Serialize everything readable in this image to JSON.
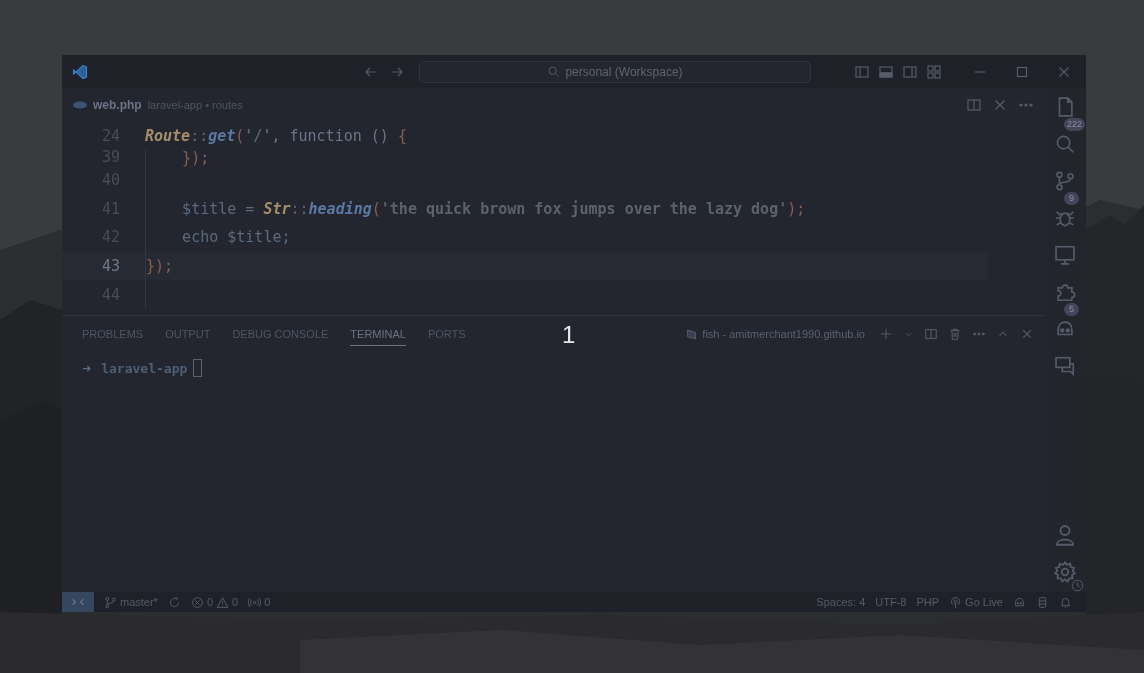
{
  "title_bar": {
    "search": "personal (Workspace)"
  },
  "editor_tab": {
    "file": "web.php",
    "breadcrumb": "laravel-app • routes"
  },
  "code": {
    "sticky": {
      "number": "24",
      "tokens": [
        {
          "text": "Route",
          "kind": "class"
        },
        {
          "text": "::",
          "kind": "op"
        },
        {
          "text": "get",
          "kind": "method"
        },
        {
          "text": "(",
          "kind": "paren"
        },
        {
          "text": "'/'",
          "kind": "string"
        },
        {
          "text": ", function () ",
          "kind": "keyword"
        },
        {
          "text": "{",
          "kind": "paren"
        }
      ]
    },
    "lines": [
      {
        "number": "39",
        "current": false,
        "tokens": [
          {
            "text": "    });",
            "kind": "paren"
          }
        ]
      },
      {
        "number": "40",
        "current": false
      },
      {
        "number": "41",
        "current": false,
        "tokens": [
          {
            "text": "    $title = ",
            "kind": "variable"
          },
          {
            "text": "Str",
            "kind": "class"
          },
          {
            "text": "::",
            "kind": "op"
          },
          {
            "text": "heading",
            "kind": "method"
          },
          {
            "text": "(",
            "kind": "paren"
          },
          {
            "text": "'the quick brown fox jumps over the lazy dog'",
            "kind": "string"
          },
          {
            "text": ");",
            "kind": "paren"
          }
        ]
      },
      {
        "number": "42",
        "current": false,
        "tokens": [
          {
            "text": "    echo $title;",
            "kind": "variable"
          }
        ]
      },
      {
        "number": "43",
        "current": true,
        "tokens": [
          {
            "text": "});",
            "kind": "paren"
          }
        ]
      },
      {
        "number": "44",
        "current": false
      }
    ]
  },
  "panel": {
    "tabs": [
      {
        "label": "PROBLEMS",
        "selected": false
      },
      {
        "label": "OUTPUT",
        "selected": false
      },
      {
        "label": "DEBUG CONSOLE",
        "selected": false
      },
      {
        "label": "TERMINAL",
        "selected": true
      },
      {
        "label": "PORTS",
        "selected": false
      }
    ],
    "counter": "1",
    "terminal_name": "fish - amitmerchant1990.github.io",
    "prompt": {
      "arrow": "➜",
      "directory": "laravel-app"
    }
  },
  "activity_bar": [
    {
      "kind": "files",
      "badge": "222"
    },
    {
      "kind": "search"
    },
    {
      "kind": "branch",
      "badge": "9"
    },
    {
      "kind": "bug"
    },
    {
      "kind": "monitor"
    },
    {
      "kind": "puzzle",
      "badge": "5"
    },
    {
      "kind": "robot"
    },
    {
      "kind": "chat"
    }
  ],
  "status_bar": {
    "branch": "master*",
    "errors": "0",
    "warnings": "0",
    "ports": "0",
    "right": [
      {
        "kind": "text",
        "label": "Spaces: 4"
      },
      {
        "kind": "text",
        "label": "UTF-8"
      },
      {
        "kind": "text",
        "label": "PHP"
      },
      {
        "kind": "live",
        "label": "Go Live"
      }
    ]
  }
}
